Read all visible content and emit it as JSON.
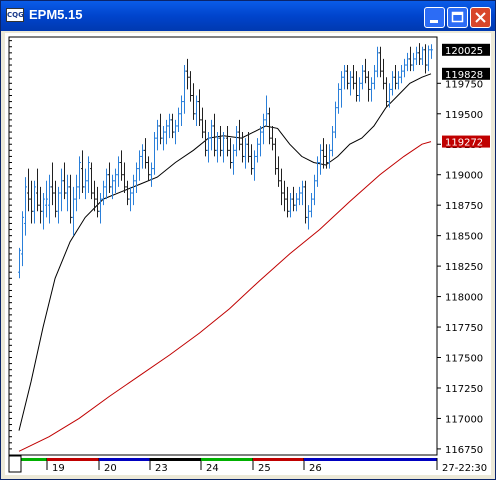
{
  "window": {
    "title": "EPM5.15",
    "app_icon": "cqg-logo-icon",
    "buttons": [
      "minimize-icon",
      "maximize-icon",
      "close-icon"
    ]
  },
  "chart_data": {
    "type": "bar",
    "style": "OHLC price bars",
    "symbol": "EPM5.15",
    "ylim": [
      116700,
      120130
    ],
    "y_ticks": [
      116750,
      117000,
      117250,
      117500,
      117750,
      118000,
      118250,
      118500,
      118750,
      119000,
      119250,
      119500,
      119750
    ],
    "x_tick_labels": [
      "19",
      "20",
      "23",
      "24",
      "25",
      "26",
      "27-22:30"
    ],
    "session_colors": [
      "#00B000",
      "#C00000",
      "#0000C0",
      "#000000",
      "#00B000",
      "#C00000",
      "#0000C0"
    ],
    "price_markers": [
      {
        "label": "120025",
        "color": "#000000",
        "value": 120025
      },
      {
        "label": "119828",
        "color": "#000000",
        "value": 119828
      },
      {
        "label": "119272",
        "color": "#C00000",
        "value": 119272
      }
    ],
    "bar_colors": {
      "up": "#2A7FD9",
      "down": "#202020"
    },
    "series": [
      {
        "name": "",
        "kind": "ohlc",
        "n": 138,
        "points": [
          [
            118200,
            118400,
            118150,
            118380
          ],
          [
            118350,
            118700,
            118250,
            118650
          ],
          [
            118600,
            118980,
            118500,
            118900
          ],
          [
            118850,
            119050,
            118700,
            118800
          ],
          [
            118800,
            118950,
            118600,
            118700
          ],
          [
            118700,
            118950,
            118600,
            118900
          ],
          [
            118850,
            119050,
            118700,
            118750
          ],
          [
            118750,
            118900,
            118600,
            118700
          ],
          [
            118700,
            118850,
            118550,
            118800
          ],
          [
            118750,
            118950,
            118650,
            118800
          ],
          [
            118750,
            119000,
            118600,
            118900
          ],
          [
            118900,
            119100,
            118750,
            118850
          ],
          [
            118850,
            118950,
            118650,
            118700
          ],
          [
            118700,
            118900,
            118600,
            118850
          ],
          [
            118850,
            119050,
            118700,
            118950
          ],
          [
            118950,
            119100,
            118800,
            118850
          ],
          [
            118850,
            119000,
            118700,
            118900
          ],
          [
            118900,
            119000,
            118600,
            118650
          ],
          [
            118650,
            118900,
            118500,
            118800
          ],
          [
            118800,
            119000,
            118700,
            118900
          ],
          [
            118900,
            119150,
            118800,
            119100
          ],
          [
            119050,
            119200,
            118850,
            118900
          ],
          [
            118900,
            119050,
            118800,
            118950
          ],
          [
            118950,
            119150,
            118850,
            119100
          ],
          [
            119050,
            119100,
            118800,
            118850
          ],
          [
            118850,
            118950,
            118700,
            118800
          ],
          [
            118800,
            118900,
            118650,
            118700
          ],
          [
            118700,
            118850,
            118600,
            118800
          ],
          [
            118800,
            118950,
            118750,
            118900
          ],
          [
            118900,
            119050,
            118800,
            119000
          ],
          [
            119000,
            119100,
            118850,
            118900
          ],
          [
            118900,
            119000,
            118800,
            118950
          ],
          [
            118950,
            119050,
            118850,
            119000
          ],
          [
            119000,
            119150,
            118900,
            119100
          ],
          [
            119100,
            119200,
            118950,
            119000
          ],
          [
            119000,
            119100,
            118850,
            118900
          ],
          [
            118900,
            118950,
            118750,
            118800
          ],
          [
            118800,
            118900,
            118700,
            118850
          ],
          [
            118850,
            119000,
            118750,
            118950
          ],
          [
            118950,
            119100,
            118850,
            119050
          ],
          [
            119050,
            119200,
            118950,
            119150
          ],
          [
            119150,
            119250,
            119050,
            119200
          ],
          [
            119200,
            119300,
            119050,
            119100
          ],
          [
            119100,
            119150,
            118950,
            119000
          ],
          [
            119000,
            119100,
            118900,
            119050
          ],
          [
            119050,
            119350,
            119000,
            119300
          ],
          [
            119300,
            119450,
            119200,
            119400
          ],
          [
            119400,
            119500,
            119250,
            119300
          ],
          [
            119300,
            119400,
            119200,
            119350
          ],
          [
            119350,
            119450,
            119250,
            119400
          ],
          [
            119400,
            119500,
            119300,
            119450
          ],
          [
            119450,
            119500,
            119300,
            119350
          ],
          [
            119350,
            119450,
            119250,
            119400
          ],
          [
            119400,
            119550,
            119350,
            119500
          ],
          [
            119500,
            119650,
            119400,
            119600
          ],
          [
            119600,
            119900,
            119500,
            119850
          ],
          [
            119850,
            119950,
            119700,
            119800
          ],
          [
            119800,
            119850,
            119600,
            119650
          ],
          [
            119650,
            119750,
            119450,
            119500
          ],
          [
            119500,
            119650,
            119400,
            119600
          ],
          [
            119600,
            119700,
            119400,
            119450
          ],
          [
            119450,
            119550,
            119300,
            119350
          ],
          [
            119350,
            119450,
            119150,
            119200
          ],
          [
            119200,
            119350,
            119100,
            119300
          ],
          [
            119300,
            119450,
            119200,
            119400
          ],
          [
            119400,
            119500,
            119150,
            119200
          ],
          [
            119200,
            119350,
            119100,
            119300
          ],
          [
            119300,
            119400,
            119150,
            119200
          ],
          [
            119200,
            119350,
            119100,
            119300
          ],
          [
            119300,
            119400,
            119150,
            119200
          ],
          [
            119200,
            119300,
            119050,
            119100
          ],
          [
            119100,
            119250,
            119000,
            119200
          ],
          [
            119200,
            119400,
            119150,
            119350
          ],
          [
            119350,
            119450,
            119200,
            119250
          ],
          [
            119250,
            119350,
            119100,
            119150
          ],
          [
            119150,
            119300,
            119050,
            119250
          ],
          [
            119250,
            119350,
            119100,
            119150
          ],
          [
            119150,
            119250,
            119000,
            119050
          ],
          [
            119050,
            119200,
            118950,
            119150
          ],
          [
            119150,
            119300,
            119100,
            119250
          ],
          [
            119250,
            119400,
            119150,
            119350
          ],
          [
            119350,
            119500,
            119250,
            119450
          ],
          [
            119450,
            119650,
            119400,
            119500
          ],
          [
            119500,
            119550,
            119250,
            119300
          ],
          [
            119300,
            119400,
            119200,
            119250
          ],
          [
            119250,
            119300,
            119000,
            119050
          ],
          [
            119050,
            119150,
            118900,
            118950
          ],
          [
            118950,
            119050,
            118750,
            118850
          ],
          [
            118850,
            118950,
            118700,
            118800
          ],
          [
            118800,
            118900,
            118650,
            118700
          ],
          [
            118700,
            118850,
            118650,
            118800
          ],
          [
            118800,
            118900,
            118700,
            118750
          ],
          [
            118750,
            118850,
            118700,
            118800
          ],
          [
            118800,
            118900,
            118750,
            118850
          ],
          [
            118850,
            118950,
            118750,
            118900
          ],
          [
            118900,
            118950,
            118600,
            118650
          ],
          [
            118650,
            118750,
            118550,
            118700
          ],
          [
            118700,
            118850,
            118650,
            118800
          ],
          [
            118800,
            119000,
            118750,
            118950
          ],
          [
            118950,
            119150,
            118900,
            119100
          ],
          [
            119100,
            119250,
            119000,
            119200
          ],
          [
            119200,
            119300,
            119050,
            119150
          ],
          [
            119150,
            119250,
            119050,
            119100
          ],
          [
            119100,
            119250,
            119050,
            119200
          ],
          [
            119200,
            119400,
            119150,
            119350
          ],
          [
            119350,
            119600,
            119300,
            119550
          ],
          [
            119550,
            119750,
            119500,
            119700
          ],
          [
            119700,
            119850,
            119550,
            119800
          ],
          [
            119800,
            119900,
            119700,
            119850
          ],
          [
            119850,
            119900,
            119700,
            119750
          ],
          [
            119750,
            119850,
            119650,
            119800
          ],
          [
            119800,
            119900,
            119700,
            119750
          ],
          [
            119750,
            119850,
            119600,
            119650
          ],
          [
            119650,
            119800,
            119600,
            119750
          ],
          [
            119750,
            119900,
            119700,
            119850
          ],
          [
            119850,
            119950,
            119750,
            119800
          ],
          [
            119800,
            119850,
            119600,
            119700
          ],
          [
            119700,
            119800,
            119600,
            119750
          ],
          [
            119750,
            119900,
            119700,
            119850
          ],
          [
            119850,
            120050,
            119800,
            120000
          ],
          [
            120000,
            120050,
            119800,
            119850
          ],
          [
            119850,
            119950,
            119700,
            119750
          ],
          [
            119750,
            119800,
            119550,
            119600
          ],
          [
            119600,
            119750,
            119550,
            119700
          ],
          [
            119700,
            119850,
            119650,
            119800
          ],
          [
            119800,
            119900,
            119700,
            119750
          ],
          [
            119750,
            119850,
            119700,
            119800
          ],
          [
            119800,
            119900,
            119750,
            119850
          ],
          [
            119850,
            119950,
            119800,
            119900
          ],
          [
            119900,
            120000,
            119850,
            119950
          ],
          [
            119950,
            120050,
            119850,
            119900
          ],
          [
            119900,
            120000,
            119850,
            119950
          ],
          [
            119950,
            120050,
            119900,
            120000
          ],
          [
            120000,
            120080,
            119900,
            119950
          ],
          [
            119950,
            120050,
            119900,
            120025
          ],
          [
            120025,
            120070,
            119830,
            119900
          ],
          [
            119900,
            120060,
            119850,
            120025
          ],
          [
            120025,
            120070,
            119950,
            120025
          ]
        ]
      },
      {
        "name": "",
        "kind": "line",
        "color": "#000000",
        "points": [
          [
            0,
            116900
          ],
          [
            4,
            117300
          ],
          [
            8,
            117750
          ],
          [
            12,
            118150
          ],
          [
            17,
            118450
          ],
          [
            22,
            118650
          ],
          [
            28,
            118800
          ],
          [
            34,
            118860
          ],
          [
            40,
            118920
          ],
          [
            46,
            118980
          ],
          [
            52,
            119100
          ],
          [
            58,
            119200
          ],
          [
            63,
            119300
          ],
          [
            68,
            119320
          ],
          [
            74,
            119300
          ],
          [
            78,
            119350
          ],
          [
            82,
            119400
          ],
          [
            86,
            119380
          ],
          [
            90,
            119250
          ],
          [
            94,
            119150
          ],
          [
            98,
            119100
          ],
          [
            102,
            119080
          ],
          [
            106,
            119150
          ],
          [
            110,
            119250
          ],
          [
            114,
            119300
          ],
          [
            118,
            119400
          ],
          [
            122,
            119550
          ],
          [
            126,
            119650
          ],
          [
            130,
            119750
          ],
          [
            134,
            119800
          ],
          [
            137,
            119828
          ]
        ]
      },
      {
        "name": "",
        "kind": "line",
        "color": "#C00000",
        "points": [
          [
            0,
            116730
          ],
          [
            10,
            116850
          ],
          [
            20,
            117000
          ],
          [
            30,
            117180
          ],
          [
            40,
            117350
          ],
          [
            50,
            117520
          ],
          [
            60,
            117700
          ],
          [
            70,
            117900
          ],
          [
            80,
            118130
          ],
          [
            90,
            118350
          ],
          [
            100,
            118550
          ],
          [
            110,
            118780
          ],
          [
            120,
            119000
          ],
          [
            128,
            119150
          ],
          [
            134,
            119250
          ],
          [
            137,
            119272
          ]
        ]
      }
    ]
  }
}
